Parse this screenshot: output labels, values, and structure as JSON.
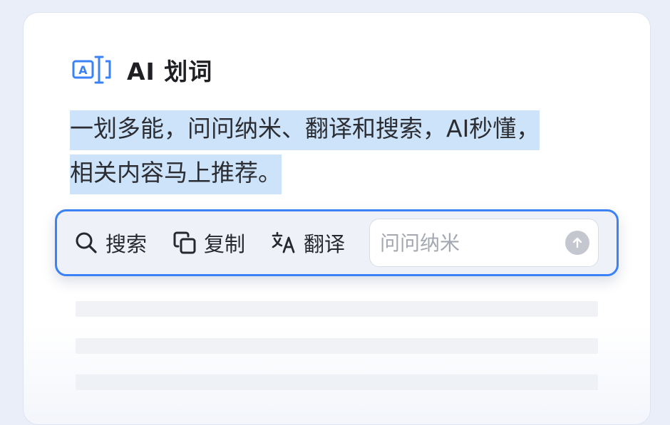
{
  "colors": {
    "accent": "#3b82f6",
    "highlight": "#cde3fa",
    "page_bg": "#e9eef8"
  },
  "header": {
    "icon": "text-selection-icon",
    "icon_letter": "A",
    "title": "AI 划词"
  },
  "description": {
    "line1": "一划多能，问问纳米、翻译和搜索，AI秒懂，",
    "line2": "相关内容马上推荐。"
  },
  "toolbar": {
    "search": {
      "icon": "search-icon",
      "label": "搜索"
    },
    "copy": {
      "icon": "copy-icon",
      "label": "复制"
    },
    "translate": {
      "icon": "translate-icon",
      "label": "翻译"
    },
    "ask": {
      "placeholder": "问问纳米",
      "value": "",
      "send_icon": "arrow-up-icon"
    }
  }
}
